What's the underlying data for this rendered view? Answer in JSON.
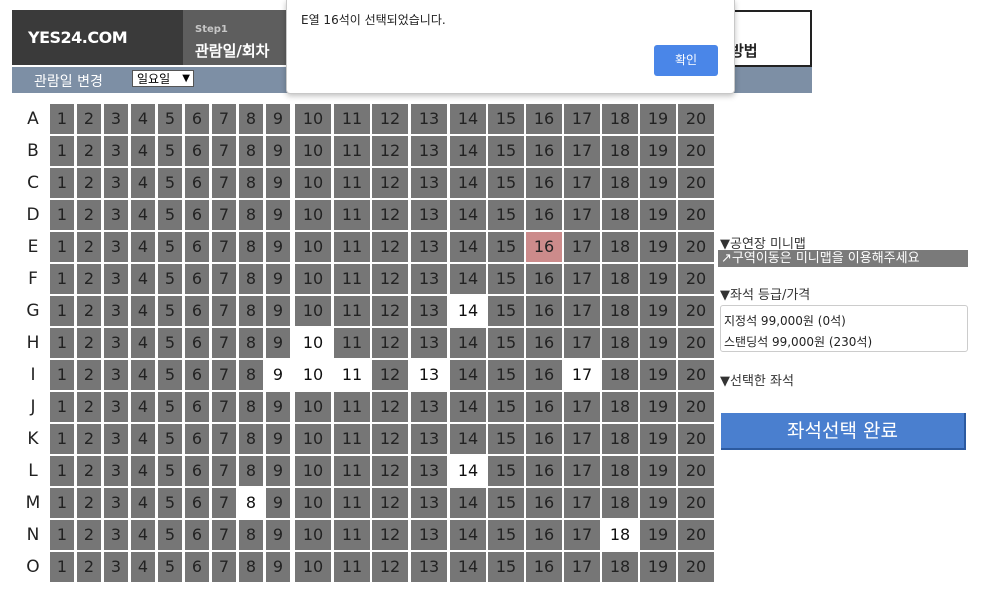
{
  "header": {
    "logo": "YES24.COM",
    "step_label": "Step1",
    "step_title": "관람일/회차",
    "method_text": "방법"
  },
  "date_bar": {
    "label": "관람일 변경",
    "selected_day": "일요일"
  },
  "seatmap": {
    "rows": [
      "A",
      "B",
      "C",
      "D",
      "E",
      "F",
      "G",
      "H",
      "I",
      "J",
      "K",
      "L",
      "M",
      "N",
      "O"
    ],
    "seat_count": 20,
    "available_seats": {
      "G": [
        14
      ],
      "H": [
        10
      ],
      "I": [
        9,
        10,
        11,
        13,
        17
      ],
      "L": [
        14
      ],
      "M": [
        8
      ],
      "N": [
        18
      ]
    },
    "selected_seat": {
      "row": "E",
      "number": 16
    },
    "colors": {
      "taken": "#767676",
      "available": "#ffffff",
      "selected": "#cc8b8b"
    }
  },
  "right_panel": {
    "minimap_heading": "▼공연장 미니맵",
    "minimap_note": "↗구역이동은 미니맵을 이용해주세요",
    "price_heading": "▼좌석 등급/가격",
    "prices": [
      "지정석 99,000원 (0석)",
      "스탠딩석 99,000원 (230석)"
    ],
    "selected_heading": "▼선택한 좌석",
    "complete_button": "좌석선택 완료"
  },
  "dialog": {
    "message": "E열 16석이 선택되었습니다.",
    "ok_label": "확인"
  },
  "colors": {
    "accent_button": "#4a7fcf",
    "dialog_button": "#4a86e8",
    "date_bar": "#7d8fa5"
  }
}
